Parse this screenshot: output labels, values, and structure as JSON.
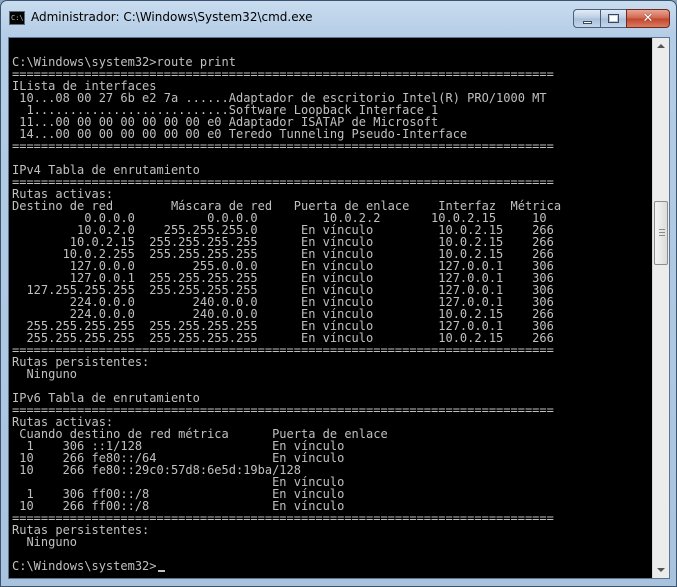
{
  "window": {
    "title": "Administrador: C:\\Windows\\System32\\cmd.exe",
    "icon": "cmd-icon",
    "icon_text": "C:\\",
    "buttons": {
      "minimize": "minimize-icon",
      "maximize": "maximize-icon",
      "close": "close-icon",
      "close_glyph": "✕"
    }
  },
  "console": {
    "lines": [
      "",
      "C:\\Windows\\system32>route print",
      "===========================================================================",
      "ILista de interfaces",
      " 10...08 00 27 6b e2 7a ......Adaptador de escritorio Intel(R) PRO/1000 MT",
      "  1...........................Software Loopback Interface 1",
      " 11...00 00 00 00 00 00 00 e0 Adaptador ISATAP de Microsoft",
      " 14...00 00 00 00 00 00 00 e0 Teredo Tunneling Pseudo-Interface",
      "===========================================================================",
      "",
      "IPv4 Tabla de enrutamiento",
      "===========================================================================",
      "Rutas activas:",
      "Destino de red        Máscara de red   Puerta de enlace    Interfaz  Métrica",
      "          0.0.0.0          0.0.0.0         10.0.2.2       10.0.2.15     10",
      "         10.0.2.0    255.255.255.0      En vínculo         10.0.2.15    266",
      "        10.0.2.15  255.255.255.255      En vínculo         10.0.2.15    266",
      "       10.0.2.255  255.255.255.255      En vínculo         10.0.2.15    266",
      "        127.0.0.0        255.0.0.0      En vínculo         127.0.0.1    306",
      "        127.0.0.1  255.255.255.255      En vínculo         127.0.0.1    306",
      "  127.255.255.255  255.255.255.255      En vínculo         127.0.0.1    306",
      "        224.0.0.0        240.0.0.0      En vínculo         127.0.0.1    306",
      "        224.0.0.0        240.0.0.0      En vínculo         10.0.2.15    266",
      "  255.255.255.255  255.255.255.255      En vínculo         127.0.0.1    306",
      "  255.255.255.255  255.255.255.255      En vínculo         10.0.2.15    266",
      "===========================================================================",
      "Rutas persistentes:",
      "  Ninguno",
      "",
      "IPv6 Tabla de enrutamiento",
      "===========================================================================",
      "Rutas activas:",
      " Cuando destino de red métrica      Puerta de enlace",
      "  1    306 ::1/128                  En vínculo",
      " 10    266 fe80::/64                En vínculo",
      " 10    266 fe80::29c0:57d8:6e5d:19ba/128",
      "                                    En vínculo",
      "  1    306 ff00::/8                 En vínculo",
      " 10    266 ff00::/8                 En vínculo",
      "===========================================================================",
      "Rutas persistentes:",
      "  Ninguno",
      "",
      "C:\\Windows\\system32>"
    ]
  },
  "scrollbar": {
    "up_icon": "scroll-up-arrow-icon",
    "down_icon": "scroll-down-arrow-icon",
    "thumb_position_fraction": 0.33
  }
}
